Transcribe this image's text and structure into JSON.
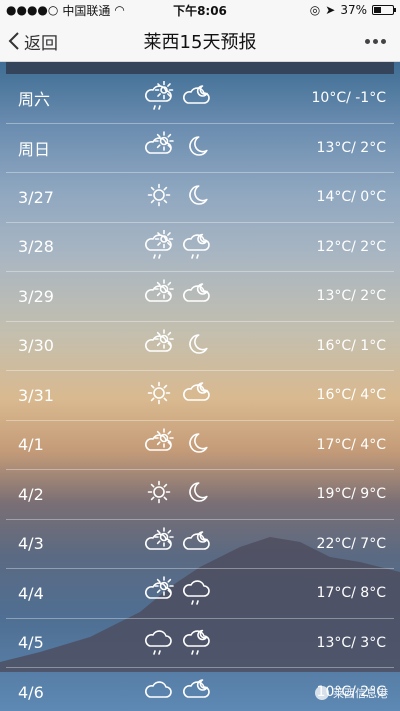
{
  "status": {
    "carrier": "中国联通",
    "time": "下午8:06",
    "battery": "37%",
    "battery_fraction": 0.37
  },
  "nav": {
    "back": "返回",
    "title": "莱西15天预报"
  },
  "forecast": [
    {
      "day": "周六",
      "temp": "10°C/ -1°C",
      "day_icon": "partly-cloudy-rain",
      "night_icon": "cloudy-night"
    },
    {
      "day": "周日",
      "temp": "13°C/ 2°C",
      "day_icon": "partly-cloudy",
      "night_icon": "clear-night"
    },
    {
      "day": "3/27",
      "temp": "14°C/ 0°C",
      "day_icon": "sunny",
      "night_icon": "clear-night"
    },
    {
      "day": "3/28",
      "temp": "12°C/ 2°C",
      "day_icon": "partly-cloudy-rain",
      "night_icon": "cloudy-night-rain"
    },
    {
      "day": "3/29",
      "temp": "13°C/ 2°C",
      "day_icon": "partly-cloudy",
      "night_icon": "cloudy-night"
    },
    {
      "day": "3/30",
      "temp": "16°C/ 1°C",
      "day_icon": "partly-cloudy",
      "night_icon": "clear-night"
    },
    {
      "day": "3/31",
      "temp": "16°C/ 4°C",
      "day_icon": "sunny",
      "night_icon": "cloudy-night"
    },
    {
      "day": "4/1",
      "temp": "17°C/ 4°C",
      "day_icon": "partly-cloudy",
      "night_icon": "clear-night"
    },
    {
      "day": "4/2",
      "temp": "19°C/ 9°C",
      "day_icon": "sunny",
      "night_icon": "clear-night"
    },
    {
      "day": "4/3",
      "temp": "22°C/ 7°C",
      "day_icon": "partly-cloudy",
      "night_icon": "cloudy-night"
    },
    {
      "day": "4/4",
      "temp": "17°C/ 8°C",
      "day_icon": "partly-cloudy",
      "night_icon": "cloudy-rain"
    },
    {
      "day": "4/5",
      "temp": "13°C/ 3°C",
      "day_icon": "cloudy-rain",
      "night_icon": "cloudy-night-rain"
    },
    {
      "day": "4/6",
      "temp": "10°C/ 2°C",
      "day_icon": "cloudy",
      "night_icon": "cloudy-night"
    }
  ],
  "watermark": "莱西信息港"
}
